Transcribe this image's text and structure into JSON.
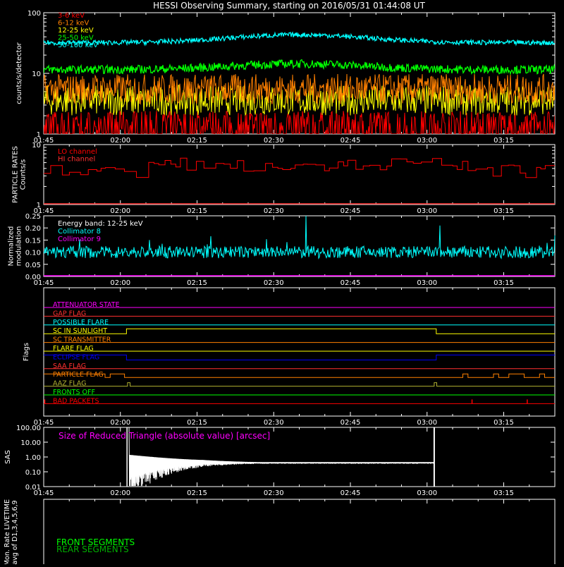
{
  "title": "HESSI Observing Summary, starting on 2016/05/31 01:44:08 UT",
  "time_ticks": [
    "01:45",
    "02:00",
    "02:15",
    "02:30",
    "02:45",
    "03:00",
    "03:15"
  ],
  "colors": {
    "bg": "#000000",
    "axis": "#ffffff",
    "red": "#ff0000",
    "orange": "#ff8000",
    "yellow": "#ffff00",
    "green": "#00ff00",
    "cyan": "#00ffff",
    "magenta": "#ff00ff",
    "blue": "#0000ff",
    "olive": "#b0b030",
    "crimson": "#ff3030",
    "darkgreen": "#00b000"
  },
  "chart_data": [
    {
      "type": "line",
      "id": "counts",
      "ylabel": "counts/s/detector",
      "yscale": "log",
      "ylim": [
        1,
        100
      ],
      "yticks": [
        "1",
        "10",
        "100"
      ],
      "x_start": "01:45",
      "x_end": "03:25",
      "series": [
        {
          "name": "3-6 keV",
          "color": "#ff0000",
          "level": 1.8,
          "noise": 0.6
        },
        {
          "name": "6-12 keV",
          "color": "#ff8000",
          "level": 5.5,
          "noise": 0.25
        },
        {
          "name": "12-25 keV",
          "color": "#ffff00",
          "level": 3.6,
          "noise": 0.25
        },
        {
          "name": "25-50 keV",
          "color": "#00ff00",
          "level": 11.5,
          "noise": 0.07
        },
        {
          "name": "50-100 keV",
          "color": "#00ffff",
          "level": 32,
          "noise": 0.04
        }
      ]
    },
    {
      "type": "line",
      "id": "particle",
      "ylabel": "PARTICLE RATES Counts/s",
      "yscale": "log",
      "ylim": [
        1,
        10
      ],
      "yticks": [
        "1",
        "10"
      ],
      "series": [
        {
          "name": "LO channel",
          "color": "#ff0000"
        },
        {
          "name": "HI channel",
          "color": "#ff3030"
        }
      ]
    },
    {
      "type": "line",
      "id": "modulation",
      "ylabel": "Normalized modulation",
      "ylim": [
        0,
        0.25
      ],
      "yticks": [
        "0.00",
        "0.05",
        "0.10",
        "0.15",
        "0.20",
        "0.25"
      ],
      "annotation": "Energy band: 12-25 keV",
      "series": [
        {
          "name": "Collimator 8",
          "color": "#00ffff",
          "level": 0.1
        },
        {
          "name": "Collimator 9",
          "color": "#ff00ff",
          "level": 0.0
        }
      ]
    },
    {
      "type": "line",
      "id": "flags",
      "ylabel": "Flags",
      "flags": [
        {
          "name": "ATTENUATOR STATE",
          "color": "#ff00ff"
        },
        {
          "name": "GAP FLAG",
          "color": "#ff3030"
        },
        {
          "name": "POSSIBLE FLARE",
          "color": "#00ffff"
        },
        {
          "name": "SC IN SUNLIGHT",
          "color": "#ffff00"
        },
        {
          "name": "SC TRANSMITTER",
          "color": "#ff8000"
        },
        {
          "name": "FLARE FLAG",
          "color": "#ffff00"
        },
        {
          "name": "ECLIPSE FLAG",
          "color": "#0000ff"
        },
        {
          "name": "SAA FLAG",
          "color": "#ff3030"
        },
        {
          "name": "PARTICLE FLAG",
          "color": "#ff8000"
        },
        {
          "name": "AAZ FLAG",
          "color": "#b0b030"
        },
        {
          "name": "FRONTS OFF",
          "color": "#00ff00"
        },
        {
          "name": "BAD PACKETS",
          "color": "#ff0000"
        }
      ]
    },
    {
      "type": "line",
      "id": "sas",
      "ylabel": "SAS",
      "yscale": "log",
      "ylim": [
        0.01,
        100
      ],
      "yticks": [
        "0.01",
        "0.10",
        "1.00",
        "10.00",
        "100.00"
      ],
      "annotation": "Size of Reduced Triangle (absolute value) [arcsec]",
      "annotation_color": "#ff00ff"
    },
    {
      "type": "line",
      "id": "livetime",
      "ylabel": "Mon. Rate LIVETIME avg of D1,3,4,5,6,9",
      "series": [
        {
          "name": "FRONT SEGMENTS",
          "color": "#00ff00"
        },
        {
          "name": "REAR SEGMENTS",
          "color": "#00b000"
        }
      ]
    }
  ]
}
